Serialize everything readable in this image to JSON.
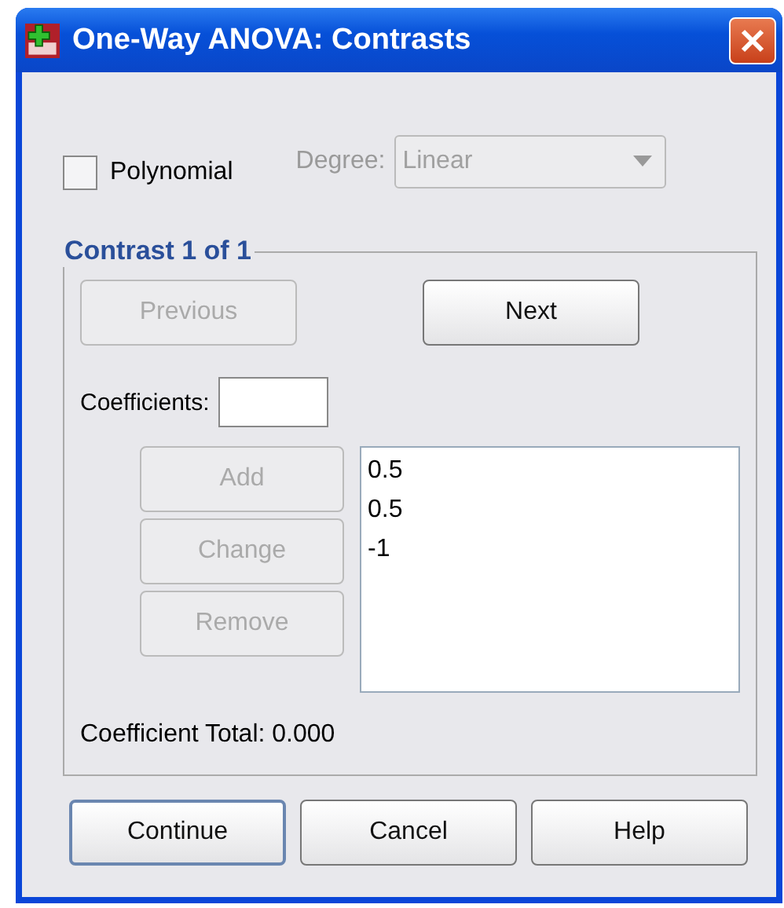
{
  "window": {
    "title": "One-Way ANOVA: Contrasts"
  },
  "polynomial": {
    "label": "Polynomial",
    "checked": false
  },
  "degree": {
    "label": "Degree:",
    "value": "Linear",
    "disabled": true
  },
  "group": {
    "title": "Contrast 1 of 1",
    "nav_buttons": [
      {
        "label": "Previous",
        "disabled": true
      },
      {
        "label": "Next",
        "disabled": false
      }
    ],
    "coefficients": {
      "label": "Coefficients:"
    },
    "list_buttons": [
      {
        "label": "Add",
        "disabled": true
      },
      {
        "label": "Change",
        "disabled": true
      },
      {
        "label": "Remove",
        "disabled": true
      }
    ],
    "values": [
      "0.5",
      "0.5",
      "-1"
    ],
    "total": "Coefficient Total: 0.000"
  },
  "buttons": [
    {
      "label": "Continue",
      "default": true
    },
    {
      "label": "Cancel",
      "default": false
    },
    {
      "label": "Help",
      "default": false
    }
  ]
}
